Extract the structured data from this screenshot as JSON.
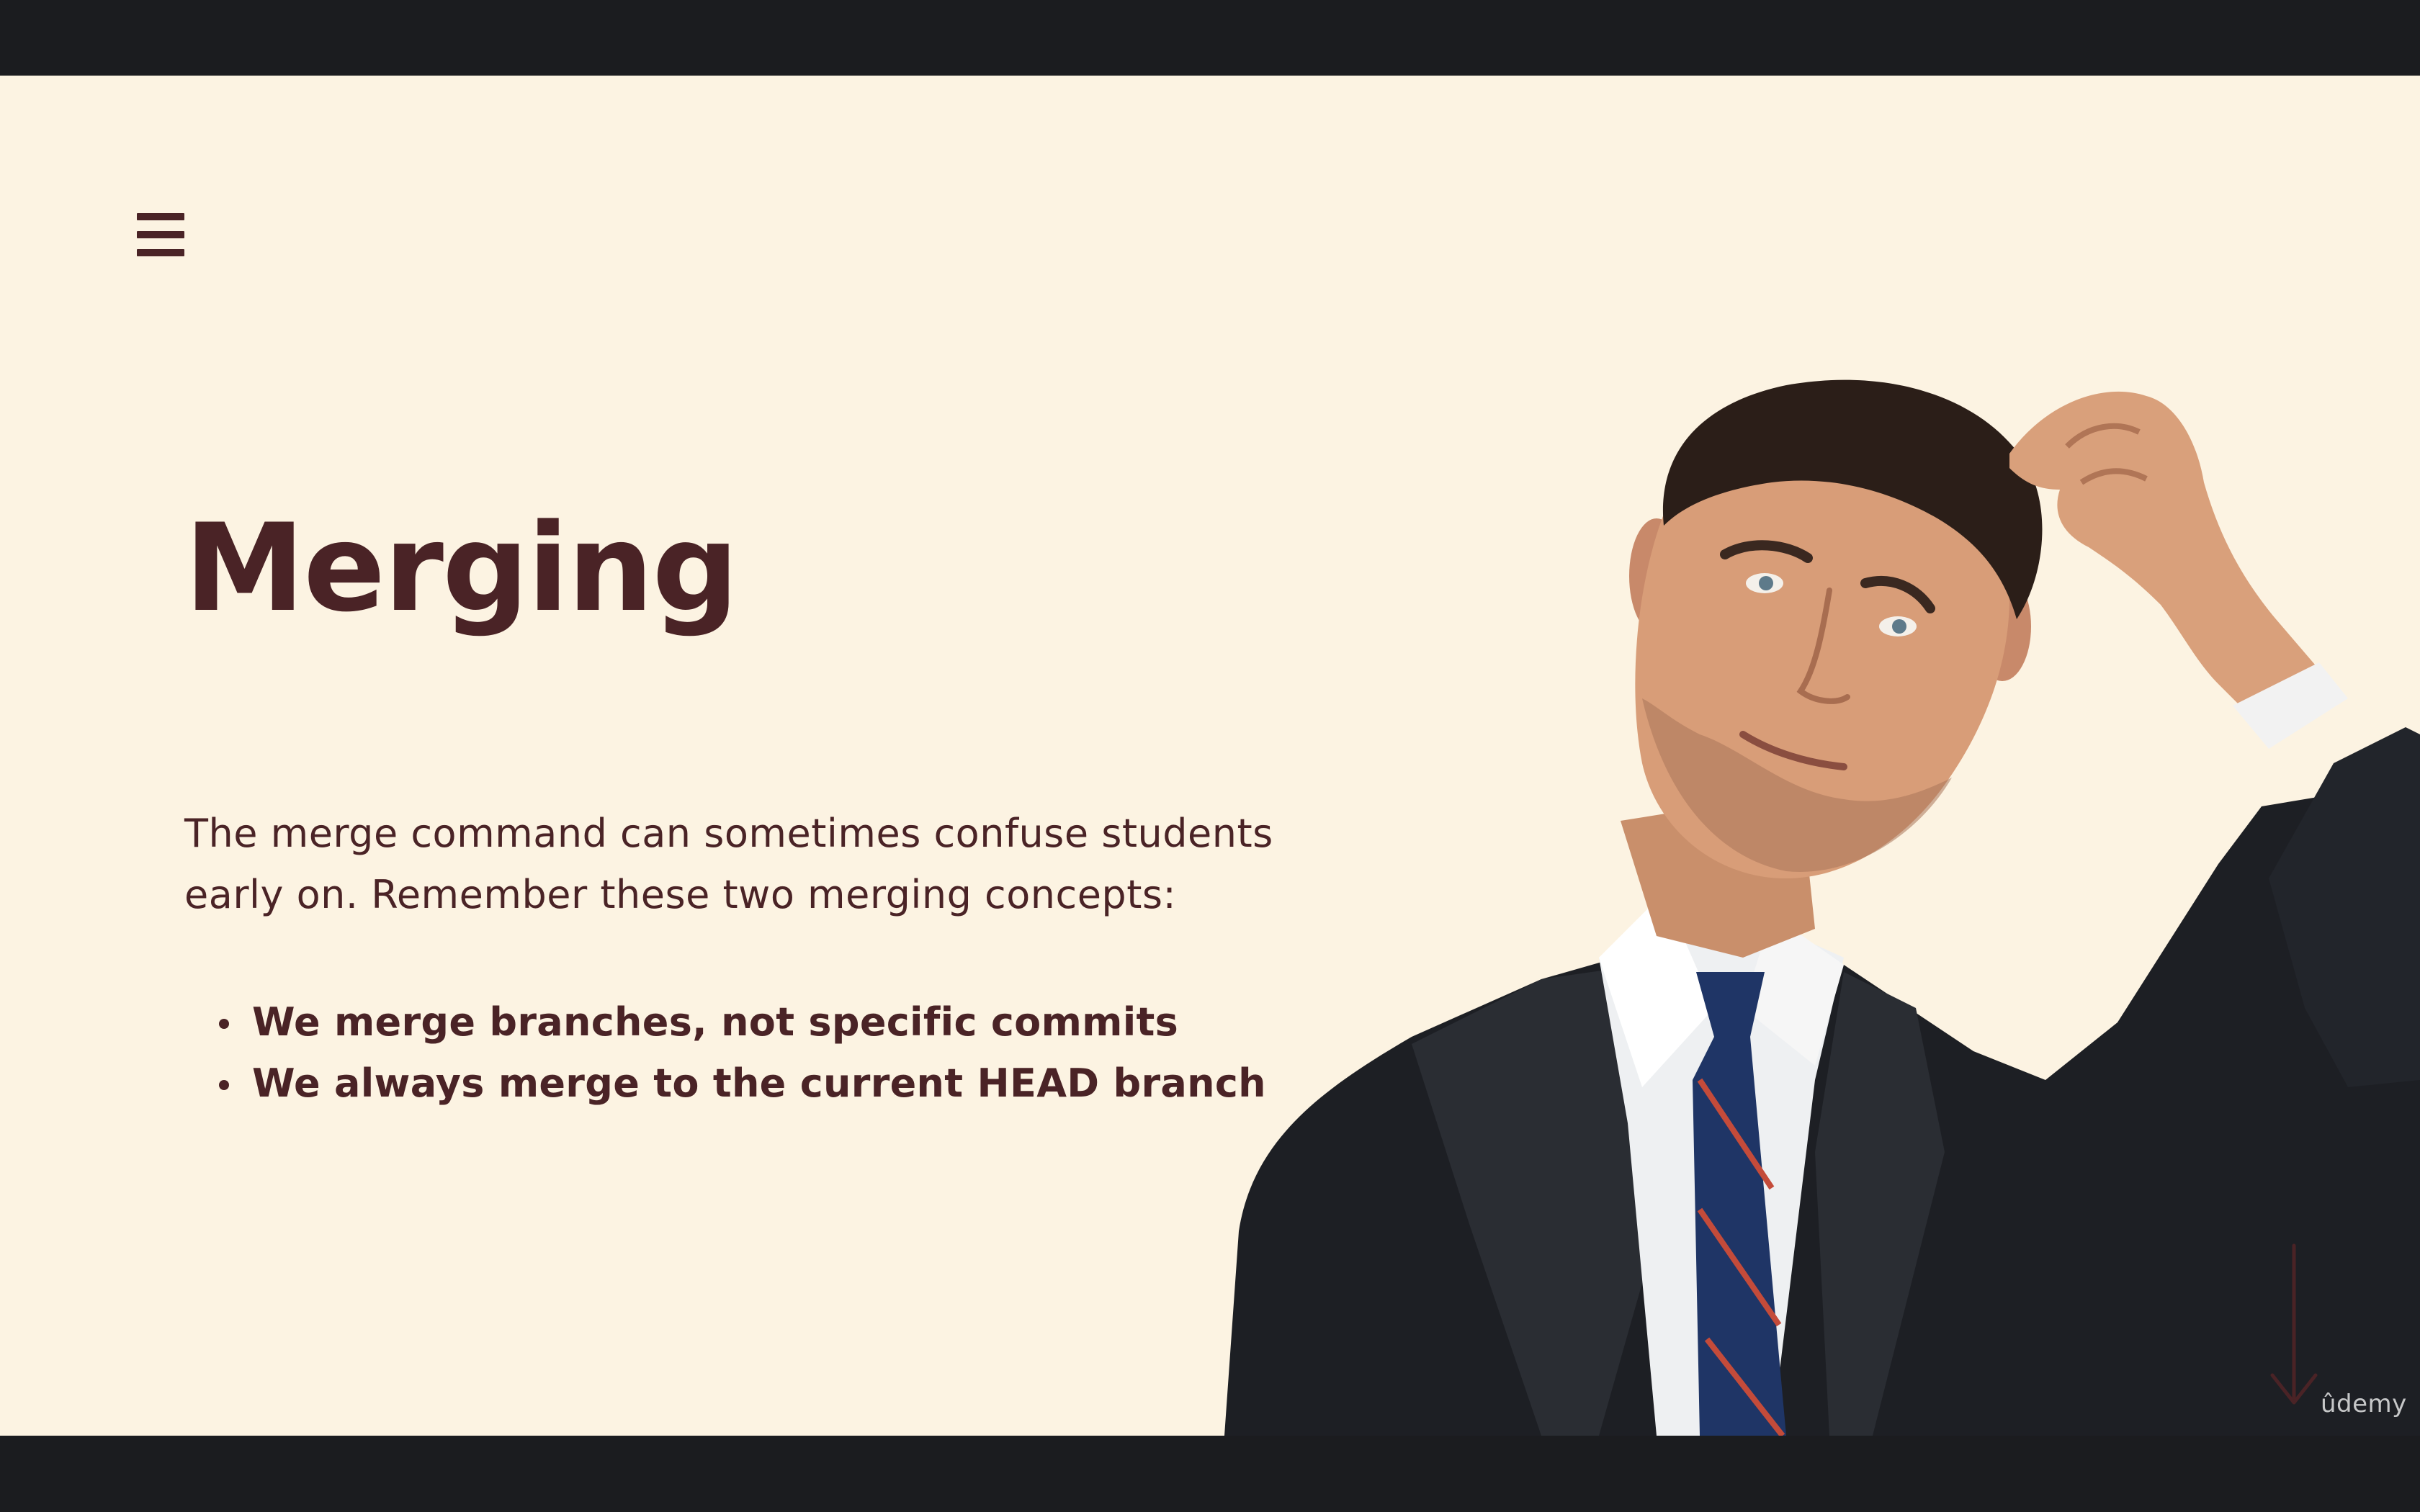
{
  "slide": {
    "title": "Merging",
    "intro": "The merge command can sometimes confuse students early on.  Remember these two merging concepts:",
    "bullets": [
      "We merge branches, not specific commits",
      "We always merge to the current HEAD branch"
    ],
    "watermark": "ûdemy"
  },
  "icons": {
    "menu": "hamburger-menu-icon",
    "next": "down-arrow-icon"
  },
  "image": {
    "subject": "confused man in suit scratching head"
  },
  "colors": {
    "background": "#fcf3e2",
    "text": "#4a2326",
    "letterbox": "#1b1c1f"
  }
}
